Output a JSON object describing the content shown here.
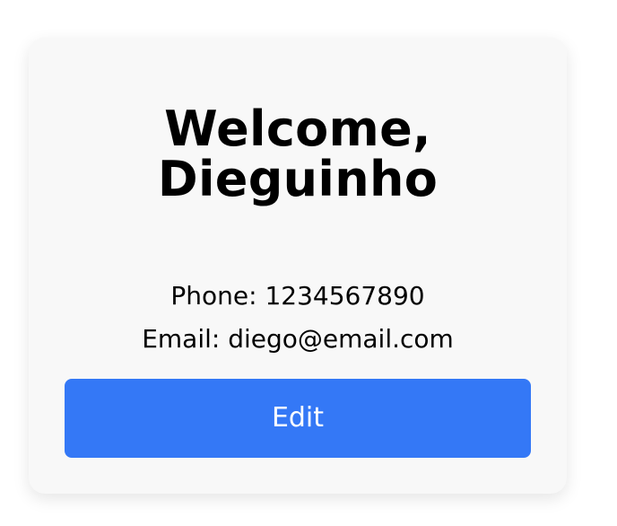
{
  "profile": {
    "welcome_line": "Welcome,",
    "name_line": "Dieguinho",
    "phone_text": "Phone: 1234567890",
    "email_text": "Email: diego@email.com",
    "edit_label": "Edit"
  },
  "colors": {
    "card_background": "#f8f8f8",
    "button_background": "#3478f6",
    "button_text": "#ffffff",
    "text": "#000000"
  }
}
